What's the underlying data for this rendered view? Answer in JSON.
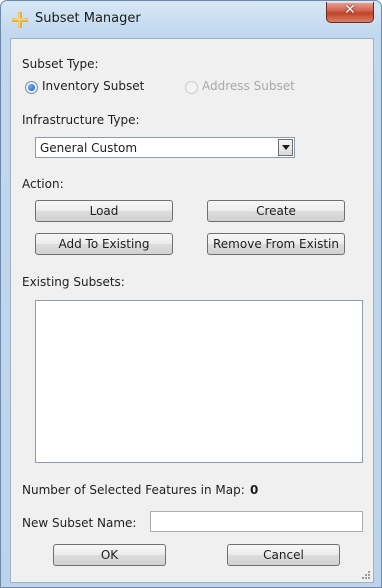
{
  "window": {
    "title": "Subset Manager"
  },
  "subset_type": {
    "label": "Subset Type:",
    "options": [
      {
        "label": "Inventory Subset",
        "selected": true,
        "enabled": true
      },
      {
        "label": "Address Subset",
        "selected": false,
        "enabled": false
      }
    ]
  },
  "infrastructure": {
    "label": "Infrastructure Type:",
    "value": "General Custom"
  },
  "action": {
    "label": "Action:",
    "load": "Load",
    "create": "Create",
    "add_to_existing": "Add To Existing",
    "remove_from_existing": "Remove From Existin"
  },
  "existing": {
    "label": "Existing Subsets:"
  },
  "selected_features": {
    "label": "Number of Selected Features in Map:",
    "count": "0"
  },
  "new_subset": {
    "label": "New Subset Name:",
    "value": ""
  },
  "footer": {
    "ok": "OK",
    "cancel": "Cancel"
  },
  "colors": {
    "title_bar": "#c1d8ef",
    "close_button": "#c24229",
    "radio_selected": "#1657b8"
  }
}
